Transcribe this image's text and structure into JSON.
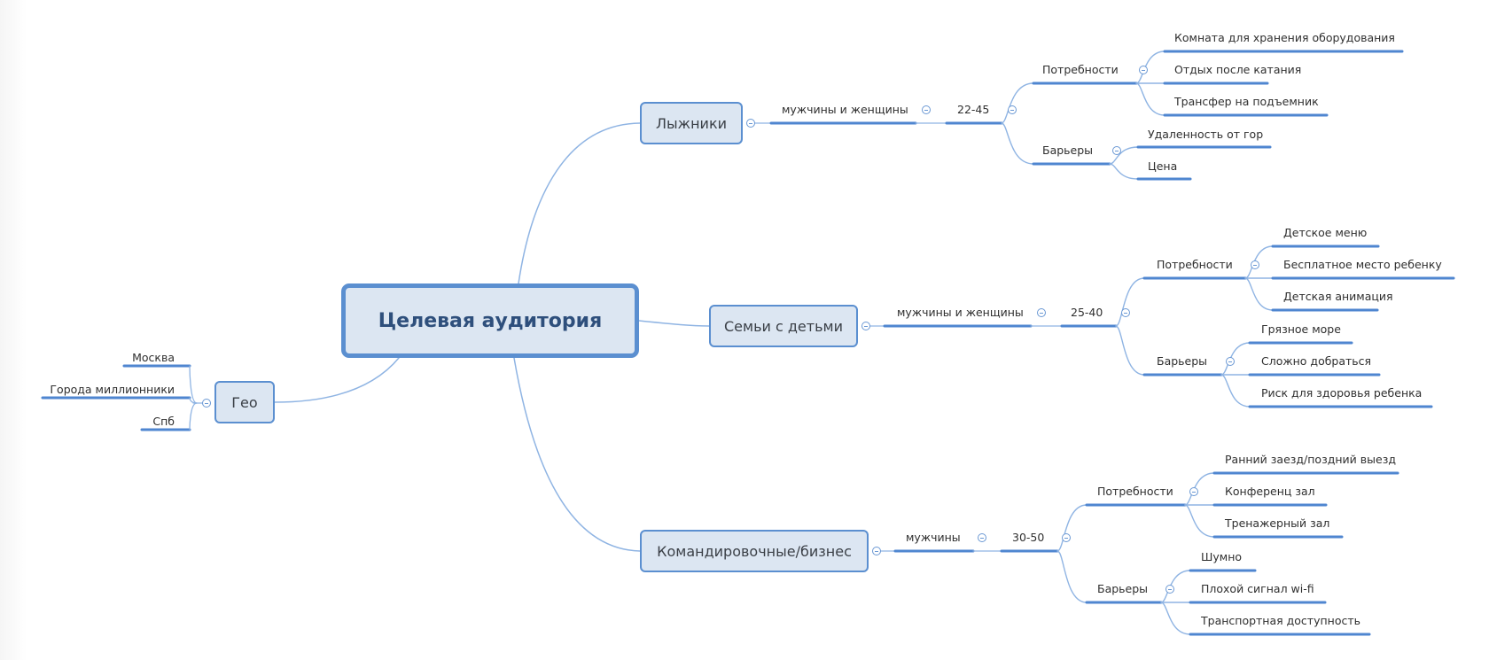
{
  "central": {
    "label": "Целевая аудитория"
  },
  "colors": {
    "branch": "#8fb4e3",
    "underline": "#4f86d0",
    "node_fill": "#dce6f2",
    "node_border": "#5b8fd0"
  },
  "geo": {
    "label": "Гео",
    "children": [
      "Москва",
      "Города миллионники",
      "Спб"
    ]
  },
  "segments": [
    {
      "label": "Лыжники",
      "gender": "мужчины и женщины",
      "age": "22-45",
      "needs": {
        "label": "Потребности",
        "items": [
          "Комната для хранения оборудования",
          "Отдых после катания",
          "Трансфер на подъемник"
        ]
      },
      "barriers": {
        "label": "Барьеры",
        "items": [
          "Удаленность от гор",
          "Цена"
        ]
      }
    },
    {
      "label": "Семьи с детьми",
      "gender": "мужчины и женщины",
      "age": "25-40",
      "needs": {
        "label": "Потребности",
        "items": [
          "Детское меню",
          "Бесплатное место ребенку",
          "Детская анимация"
        ]
      },
      "barriers": {
        "label": "Барьеры",
        "items": [
          "Грязное море",
          "Сложно добраться",
          "Риск для здоровья ребенка"
        ]
      }
    },
    {
      "label": "Командировочные/бизнес",
      "gender": "мужчины",
      "age": "30-50",
      "needs": {
        "label": "Потребности",
        "items": [
          "Ранний заезд/поздний выезд",
          "Конференц зал",
          "Тренажерный зал"
        ]
      },
      "barriers": {
        "label": "Барьеры",
        "items": [
          "Шумно",
          "Плохой сигнал wi-fi",
          "Транспортная доступность"
        ]
      }
    }
  ]
}
